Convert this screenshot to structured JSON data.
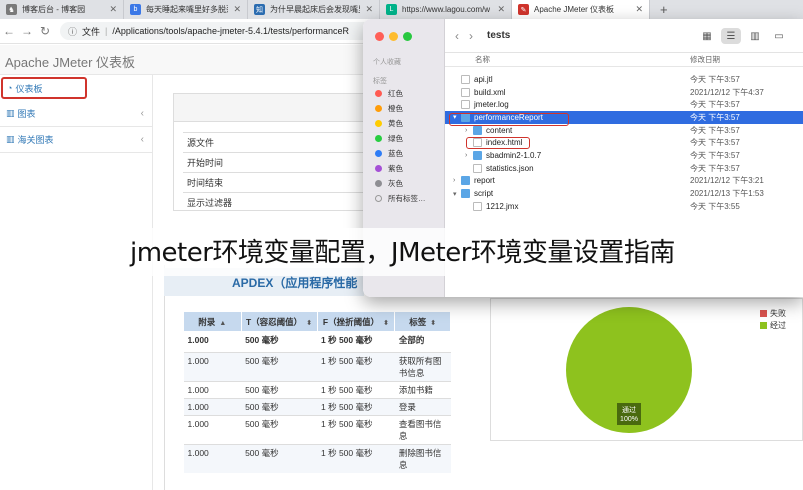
{
  "browser": {
    "tabs": [
      {
        "label": "博客后台 - 博客园",
        "icon": "cnblogs-icon",
        "color": "#7a7a7a",
        "glyph": "♞"
      },
      {
        "label": "每天睡起来嘴里好多脱落的",
        "icon": "baidu-icon",
        "color": "#3b78e7",
        "glyph": "b"
      },
      {
        "label": "为什早晨起床后会发现嘴里",
        "icon": "site-icon",
        "color": "#2b6cb0",
        "glyph": "知"
      },
      {
        "label": "https://www.lagou.com/w",
        "icon": "lagou-icon",
        "color": "#00b38a",
        "glyph": "L"
      },
      {
        "label": "Apache JMeter 仪表板",
        "icon": "jmeter-icon",
        "color": "#d0342c",
        "glyph": "✎"
      }
    ],
    "new_tab": "+",
    "address": {
      "scheme": "文件",
      "path": "/Applications/tools/apache-jmeter-5.4.1/tests/performanceR"
    }
  },
  "jmeter": {
    "brand": "Apache JMeter 仪表板",
    "sidebar": [
      {
        "label": "仪表板",
        "icon": "dashboard-icon",
        "glyph": "◔"
      },
      {
        "label": "图表",
        "icon": "bar-chart-icon",
        "glyph": "▥"
      },
      {
        "label": "海关图表",
        "icon": "bar-chart-icon",
        "glyph": "▥"
      }
    ],
    "info_rows": [
      "源文件",
      "开始时间",
      "时间结束",
      "显示过滤器"
    ],
    "apdex_title": "APDEX（应用程序性能",
    "apdex_table": {
      "headers": [
        "附录",
        "T（容忍阈值）",
        "F（挫折阈值）",
        "标签"
      ],
      "rows": [
        [
          "1.000",
          "500 毫秒",
          "1 秒 500 毫秒",
          "全部的"
        ],
        [
          "1.000",
          "500 毫秒",
          "1 秒 500 毫秒",
          "获取所有图书信息"
        ],
        [
          "1.000",
          "500 毫秒",
          "1 秒 500 毫秒",
          "添加书籍"
        ],
        [
          "1.000",
          "500 毫秒",
          "1 秒 500 毫秒",
          "登录"
        ],
        [
          "1.000",
          "500 毫秒",
          "1 秒 500 毫秒",
          "查看图书信息"
        ],
        [
          "1.000",
          "500 毫秒",
          "1 秒 500 毫秒",
          "删除图书信息"
        ]
      ]
    }
  },
  "chart_data": {
    "type": "pie",
    "slices": [
      {
        "label": "失败",
        "value": 0,
        "color": "#d9534f"
      },
      {
        "label": "经过",
        "value": 100,
        "color": "#8ec21e"
      }
    ],
    "data_label": "通过",
    "data_value": "100%",
    "legend_position": "top-right"
  },
  "finder": {
    "title": "tests",
    "sidebar_sections": {
      "personal": "个人收藏",
      "tags": "标签"
    },
    "tags": [
      {
        "label": "红色",
        "color": "#ff5b52"
      },
      {
        "label": "橙色",
        "color": "#ff9d0a"
      },
      {
        "label": "黄色",
        "color": "#ffcc00"
      },
      {
        "label": "绿色",
        "color": "#28cd41"
      },
      {
        "label": "蓝色",
        "color": "#2f7df6"
      },
      {
        "label": "紫色",
        "color": "#a550d6"
      },
      {
        "label": "灰色",
        "color": "#8e8e93"
      },
      {
        "label": "所有标签…",
        "color": ""
      }
    ],
    "columns": {
      "name": "名称",
      "date": "修改日期"
    },
    "files": [
      {
        "name": "api.jtl",
        "date": "今天 下午3:57",
        "kind": "doc",
        "depth": 0,
        "disclosure": ""
      },
      {
        "name": "build.xml",
        "date": "2021/12/12 下午4:37",
        "kind": "doc",
        "depth": 0,
        "disclosure": ""
      },
      {
        "name": "jmeter.log",
        "date": "今天 下午3:57",
        "kind": "doc",
        "depth": 0,
        "disclosure": ""
      },
      {
        "name": "performanceReport",
        "date": "今天 下午3:57",
        "kind": "folder",
        "depth": 0,
        "disclosure": "▾",
        "selected": true
      },
      {
        "name": "content",
        "date": "今天 下午3:57",
        "kind": "folder",
        "depth": 1,
        "disclosure": "›"
      },
      {
        "name": "index.html",
        "date": "今天 下午3:57",
        "kind": "doc",
        "depth": 1,
        "disclosure": ""
      },
      {
        "name": "sbadmin2-1.0.7",
        "date": "今天 下午3:57",
        "kind": "folder",
        "depth": 1,
        "disclosure": "›"
      },
      {
        "name": "statistics.json",
        "date": "今天 下午3:57",
        "kind": "doc",
        "depth": 1,
        "disclosure": ""
      },
      {
        "name": "report",
        "date": "2021/12/12 下午3:21",
        "kind": "folder",
        "depth": 0,
        "disclosure": "›"
      },
      {
        "name": "script",
        "date": "2021/12/13 下午1:53",
        "kind": "folder",
        "depth": 0,
        "disclosure": "▾"
      },
      {
        "name": "1212.jmx",
        "date": "今天 下午3:55",
        "kind": "doc",
        "depth": 1,
        "disclosure": ""
      }
    ]
  },
  "overlay": {
    "text": "jmeter环境变量配置，JMeter环境变量设置指南"
  }
}
